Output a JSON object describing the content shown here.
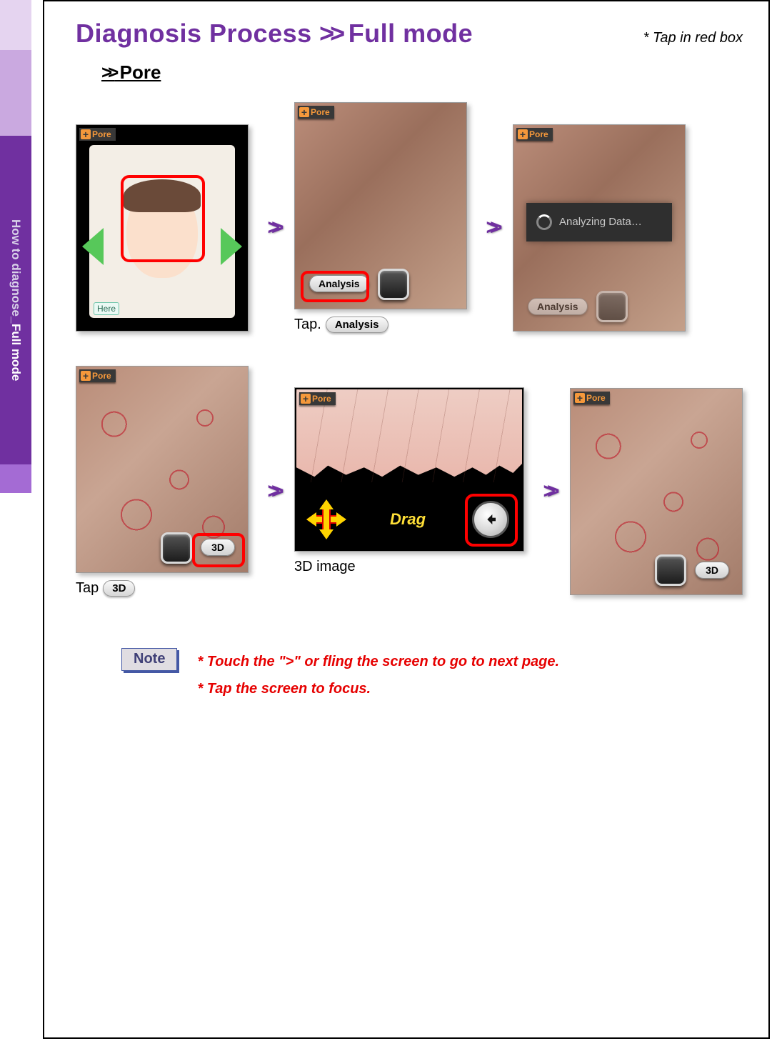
{
  "sidebar": {
    "tab3": {
      "prefix": "How to diagnose_ ",
      "em": "Full mode"
    }
  },
  "header": {
    "title_prefix": "Diagnosis Process ",
    "title_chevrons": ">>",
    "title_suffix": " Full mode",
    "hint": "* Tap in red box"
  },
  "subheading": {
    "chevrons": ">>",
    "label": " Pore"
  },
  "pore_badge": {
    "plus": "+",
    "label": "Pore"
  },
  "shots": {
    "face": {
      "here": "Here"
    },
    "skin1": {
      "analysis_btn": "Analysis"
    },
    "skin1_caption": {
      "prefix": "Tap.",
      "pill": "Analysis"
    },
    "skin2": {
      "analyzing": "Analyzing Data…",
      "analysis_btn": "Analysis"
    },
    "skin3": {
      "threeD_btn": "3D"
    },
    "skin3_caption": {
      "prefix": "Tap",
      "pill": "3D"
    },
    "threeD": {
      "drag": "Drag"
    },
    "threeD_caption": "3D image",
    "skin4": {
      "threeD_btn": "3D"
    }
  },
  "chevrons": ">>",
  "note": {
    "badge": "Note",
    "line1": "* Touch the \">\" or fling the screen to go to next page.",
    "line2": "* Tap the screen to focus."
  }
}
